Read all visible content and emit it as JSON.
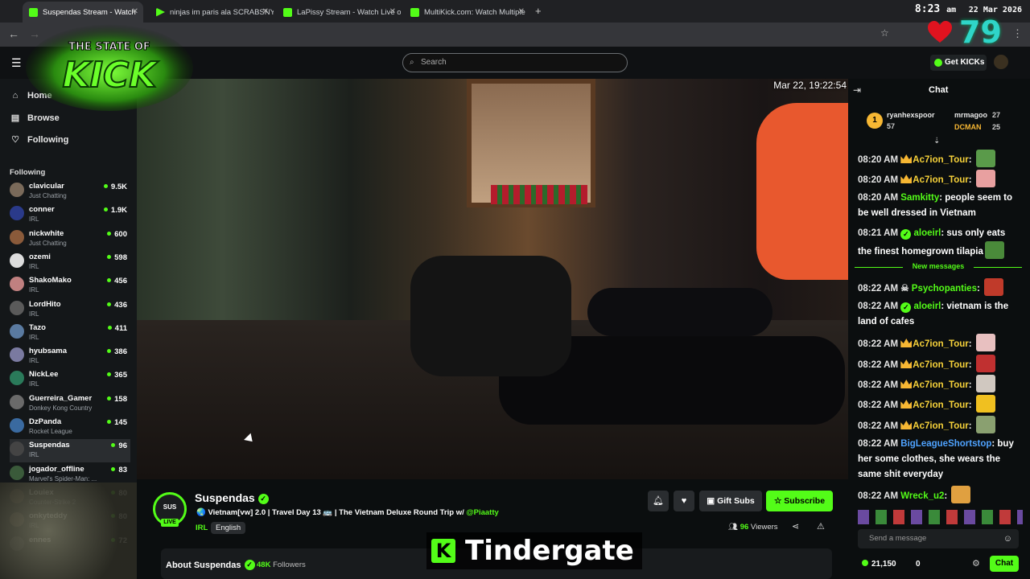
{
  "browser": {
    "tabs": [
      {
        "title": "Suspendas Stream - Watch",
        "active": true,
        "fav_color": "#53fc18",
        "audio_icon": "speaker-icon"
      },
      {
        "title": "ninjas im paris ala SCRABSNYC",
        "active": false,
        "fav_color": "#53fc18"
      },
      {
        "title": "LaPissy Stream - Watch Live on",
        "active": false,
        "fav_color": "#53fc18"
      },
      {
        "title": "MultiKick.com: Watch Multiple",
        "active": false,
        "fav_color": "#53fc18"
      }
    ],
    "new_tab": "+",
    "clock_time": "8:23",
    "clock_ampm": "am",
    "clock_date": "22 Mar 2026"
  },
  "overlay": {
    "logo_line1": "THE STATE OF",
    "logo_line2": "KICK",
    "counter": "79",
    "caption": "Tindergate",
    "caption_logo": "K"
  },
  "site": {
    "search_placeholder": "Search",
    "get_kicks": "Get KICKs",
    "nav": [
      {
        "label": "Home",
        "icon": "home-icon"
      },
      {
        "label": "Browse",
        "icon": "browse-icon"
      },
      {
        "label": "Following",
        "icon": "heart-icon"
      }
    ],
    "following_header": "Following",
    "following": [
      {
        "name": "clavicular",
        "category": "Just Chatting",
        "viewers": "9.5K"
      },
      {
        "name": "conner",
        "category": "IRL",
        "viewers": "1.9K"
      },
      {
        "name": "nickwhite",
        "category": "Just Chatting",
        "viewers": "600"
      },
      {
        "name": "ozemi",
        "category": "IRL",
        "viewers": "598"
      },
      {
        "name": "ShakoMako",
        "category": "IRL",
        "viewers": "456"
      },
      {
        "name": "LordHito",
        "category": "IRL",
        "viewers": "436"
      },
      {
        "name": "Tazo",
        "category": "IRL",
        "viewers": "411"
      },
      {
        "name": "hyubsama",
        "category": "IRL",
        "viewers": "386"
      },
      {
        "name": "NickLee",
        "category": "IRL",
        "viewers": "365"
      },
      {
        "name": "Guerreira_Gamer",
        "category": "Donkey Kong Country",
        "viewers": "158"
      },
      {
        "name": "DzPanda",
        "category": "Rocket League",
        "viewers": "145"
      },
      {
        "name": "Suspendas",
        "category": "IRL",
        "viewers": "96"
      },
      {
        "name": "jogador_offline",
        "category": "Marvel's Spider-Man: ...",
        "viewers": "83"
      },
      {
        "name": "Louiex",
        "category": "Counter-Strike 2",
        "viewers": "80"
      },
      {
        "name": "onkyteddy",
        "category": "IRL",
        "viewers": "80"
      },
      {
        "name": "ennes",
        "category": "",
        "viewers": "72"
      }
    ]
  },
  "video": {
    "timestamp": "Mar 22, 19:22:54"
  },
  "channel": {
    "name": "Suspendas",
    "live_label": "LIVE",
    "avatar_text": "SUS",
    "title_prefix": "🌏 Vietnam[vw] 2.0 | Travel Day 13 🚌 | The Vietnam Deluxe Round Trip w/ ",
    "title_mention": "@Piaatty",
    "category": "IRL",
    "language": "English",
    "gift_subs": "Gift Subs",
    "subscribe": "Subscribe",
    "viewers_count": "96",
    "viewers_label": "Viewers",
    "about_title": "About Suspendas",
    "followers_count": "48K",
    "followers_label": "Followers"
  },
  "chat": {
    "title": "Chat",
    "top_gifters": [
      {
        "rank": "1",
        "name": "ryanhexspoor",
        "count": "57"
      },
      {
        "name": "mrmagoo",
        "count": "27"
      },
      {
        "name": "DCMAN",
        "count": "25"
      }
    ],
    "messages": [
      {
        "time": "08:20 AM",
        "user": "Ac7ion_Tour",
        "badge": "crown",
        "text": "",
        "emote_color": "#5a9a4a",
        "color": "gold"
      },
      {
        "time": "08:20 AM",
        "user": "Ac7ion_Tour",
        "badge": "crown",
        "text": "",
        "emote_color": "#e8a0a0",
        "color": "gold"
      },
      {
        "time": "08:20 AM",
        "user": "Samkitty",
        "badge": "",
        "text": "people seem to be well dressed in Vietnam",
        "color": "green"
      },
      {
        "time": "08:21 AM",
        "user": "aloeirl",
        "badge": "check",
        "text": "sus only eats the finest homegrown tilapia",
        "emote_color": "#4a8a3a",
        "color": "green"
      },
      {
        "time": "08:22 AM",
        "user": "Psychopanties",
        "badge": "skull",
        "text": "",
        "emote_color": "#c03a2a",
        "color": "green"
      },
      {
        "time": "08:22 AM",
        "user": "aloeirl",
        "badge": "check",
        "text": "vietnam is the land of cafes",
        "color": "green"
      },
      {
        "time": "08:22 AM",
        "user": "Ac7ion_Tour",
        "badge": "crown",
        "text": "",
        "emote_color": "#e8c0c0",
        "color": "gold"
      },
      {
        "time": "08:22 AM",
        "user": "Ac7ion_Tour",
        "badge": "crown",
        "text": "",
        "emote_color": "#c03030",
        "color": "gold"
      },
      {
        "time": "08:22 AM",
        "user": "Ac7ion_Tour",
        "badge": "crown",
        "text": "",
        "emote_color": "#d0c8c0",
        "color": "gold"
      },
      {
        "time": "08:22 AM",
        "user": "Ac7ion_Tour",
        "badge": "crown",
        "text": "",
        "emote_color": "#f0c020",
        "color": "gold"
      },
      {
        "time": "08:22 AM",
        "user": "Ac7ion_Tour",
        "badge": "crown",
        "text": "",
        "emote_color": "#8aa070",
        "color": "gold"
      },
      {
        "time": "08:22 AM",
        "user": "BigLeagueShortstop",
        "badge": "",
        "text": "buy her some clothes, she wears the same shit everyday",
        "color": "blue"
      },
      {
        "time": "08:22 AM",
        "user": "Wreck_u2",
        "badge": "",
        "text": "",
        "emote_color": "#e0a040",
        "color": "green"
      }
    ],
    "new_messages": "New messages",
    "send_placeholder": "Send a message",
    "kicks": "21,150",
    "zero": "0",
    "chat_button": "Chat"
  },
  "colors": {
    "accent": "#53fc18",
    "bg": "#0b0e0f"
  }
}
